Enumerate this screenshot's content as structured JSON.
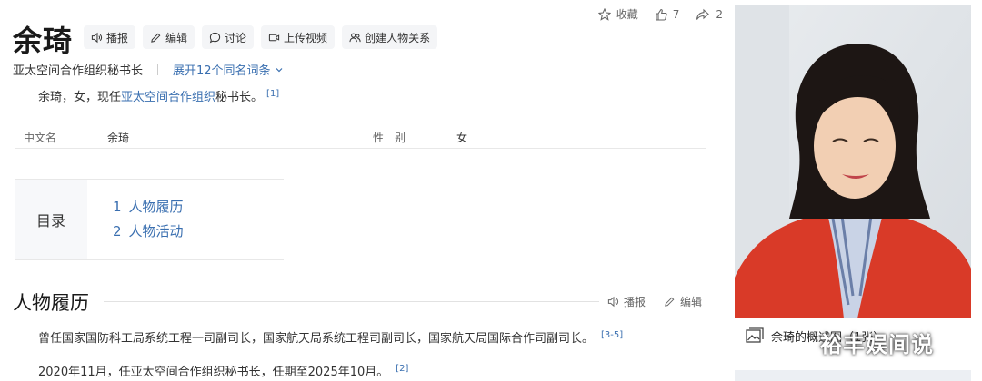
{
  "top_actions": {
    "favorite_label": "收藏",
    "like_count": "7",
    "share_count": "2"
  },
  "entry": {
    "title": "余琦",
    "toolbar": [
      "播报",
      "编辑",
      "讨论",
      "上传视频",
      "创建人物关系"
    ],
    "subtitle": "亚太空间合作组织秘书长",
    "homonyms_link": "展开12个同名词条",
    "summary_prefix": "余琦，女，现任",
    "summary_link": "亚太空间合作组织",
    "summary_suffix": "秘书长。",
    "summary_ref": "[1]"
  },
  "info_box": {
    "name_label": "中文名",
    "name_value": "余琦",
    "gender_label": "性　别",
    "gender_value": "女"
  },
  "toc": {
    "label": "目录",
    "items": [
      {
        "num": "1",
        "label": "人物履历"
      },
      {
        "num": "2",
        "label": "人物活动"
      }
    ]
  },
  "section": {
    "title": "人物履历",
    "broadcast_label": "播报",
    "edit_label": "编辑",
    "paragraphs": [
      {
        "text": "曾任国家国防科工局系统工程一司副司长，国家航天局系统工程司副司长，国家航天局国际合作司副司长。",
        "ref": "[3-5]"
      },
      {
        "text": "2020年11月，任亚太空间合作组织秘书长，任期至2025年10月。",
        "ref": "[2]"
      }
    ]
  },
  "image_panel": {
    "caption": "余琦的概述图（1张）",
    "watermark": "裕丰娱间说"
  },
  "colors": {
    "link": "#3a6fb0",
    "jacket": "#d93a28"
  }
}
